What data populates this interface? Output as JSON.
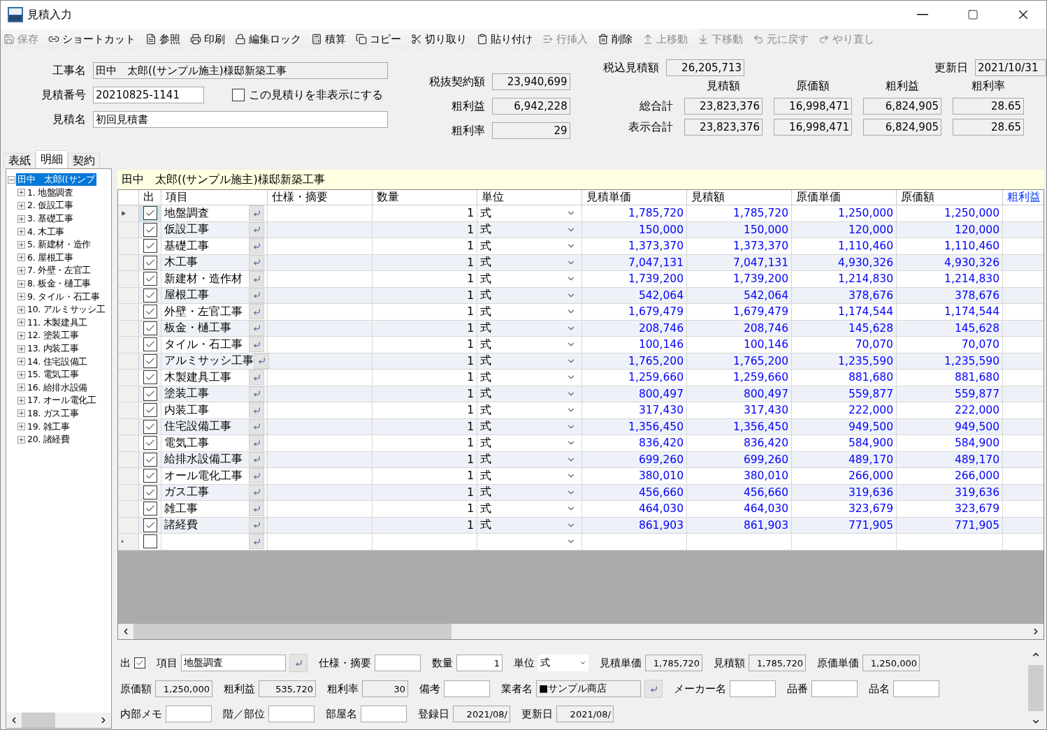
{
  "window": {
    "title": "見積入力"
  },
  "toolbar": [
    {
      "label": "保存",
      "disabled": true
    },
    {
      "label": "ショートカット",
      "disabled": false
    },
    {
      "label": "参照",
      "disabled": false
    },
    {
      "label": "印刷",
      "disabled": false
    },
    {
      "label": "編集ロック",
      "disabled": false
    },
    {
      "label": "積算",
      "disabled": false
    },
    {
      "label": "コピー",
      "disabled": false
    },
    {
      "label": "切り取り",
      "disabled": false
    },
    {
      "label": "貼り付け",
      "disabled": false
    },
    {
      "label": "行挿入",
      "disabled": true
    },
    {
      "label": "削除",
      "disabled": false
    },
    {
      "label": "上移動",
      "disabled": true
    },
    {
      "label": "下移動",
      "disabled": true
    },
    {
      "label": "元に戻す",
      "disabled": true
    },
    {
      "label": "やり直し",
      "disabled": true
    }
  ],
  "header": {
    "project_name": {
      "label": "工事名",
      "value": "田中　太郎((サンプル施主)様邸新築工事"
    },
    "estimate_number": {
      "label": "見積番号",
      "value": "20210825-1141"
    },
    "hide_option": {
      "label": "この見積りを非表示にする",
      "checked": false
    },
    "estimate_name": {
      "label": "見積名",
      "value": "初回見積書"
    },
    "contract": [
      {
        "label": "税抜契約額",
        "value": "23,940,699"
      },
      {
        "label": "粗利益",
        "value": "6,942,228"
      },
      {
        "label": "粗利率",
        "value": "29"
      }
    ],
    "tax_included": {
      "label": "税込見積額",
      "value": "26,205,713"
    },
    "updated": {
      "label": "更新日",
      "value": "2021/10/31"
    },
    "summary": {
      "columns": [
        "見積額",
        "原価額",
        "粗利益",
        "粗利率"
      ],
      "rows": [
        {
          "label": "総合計",
          "values": [
            "23,823,376",
            "16,998,471",
            "6,824,905",
            "28.65"
          ]
        },
        {
          "label": "表示合計",
          "values": [
            "23,823,376",
            "16,998,471",
            "6,824,905",
            "28.65"
          ]
        }
      ]
    }
  },
  "tabs": [
    {
      "label": "表紙",
      "selected": false
    },
    {
      "label": "明細",
      "selected": true
    },
    {
      "label": "契約",
      "selected": false
    }
  ],
  "tree": {
    "root": {
      "label": "田中　太郎((サンプ",
      "selected": true,
      "expanded": true,
      "children": [
        {
          "label": "1. 地盤調査",
          "expanded": false
        },
        {
          "label": "2. 仮設工事",
          "expanded": false
        },
        {
          "label": "3. 基礎工事",
          "expanded": false
        },
        {
          "label": "4. 木工事",
          "expanded": false
        },
        {
          "label": "5. 新建材・造作",
          "expanded": false
        },
        {
          "label": "6. 屋根工事",
          "expanded": false
        },
        {
          "label": "7. 外壁・左官工",
          "expanded": false
        },
        {
          "label": "8. 板金・樋工事",
          "expanded": false
        },
        {
          "label": "9. タイル・石工事",
          "expanded": false
        },
        {
          "label": "10. アルミサッシ工",
          "expanded": false
        },
        {
          "label": "11. 木製建具工",
          "expanded": false
        },
        {
          "label": "12. 塗装工事",
          "expanded": false
        },
        {
          "label": "13. 内装工事",
          "expanded": false
        },
        {
          "label": "14. 住宅設備工",
          "expanded": false
        },
        {
          "label": "15. 電気工事",
          "expanded": false
        },
        {
          "label": "16. 給排水設備",
          "expanded": false
        },
        {
          "label": "17. オール電化工",
          "expanded": false
        },
        {
          "label": "18. ガス工事",
          "expanded": false
        },
        {
          "label": "19. 雑工事",
          "expanded": false
        },
        {
          "label": "20. 諸経費",
          "expanded": false
        }
      ]
    }
  },
  "grid": {
    "caption": "田中　太郎((サンプル施主)様邸新築工事",
    "columns": [
      {
        "label": "出",
        "accent": false
      },
      {
        "label": "項目",
        "accent": false
      },
      {
        "label": "仕様・摘要",
        "accent": false
      },
      {
        "label": "数量",
        "accent": false
      },
      {
        "label": "単位",
        "accent": false
      },
      {
        "label": "見積単価",
        "accent": false
      },
      {
        "label": "見積額",
        "accent": false
      },
      {
        "label": "原価単価",
        "accent": false
      },
      {
        "label": "原価額",
        "accent": false
      },
      {
        "label": "粗利益",
        "accent": true
      }
    ],
    "rows": [
      {
        "kind": "item",
        "selected": true,
        "checked": true,
        "item": "地盤調査",
        "quantity": "1",
        "unit": "式",
        "unit_price": "1,785,720",
        "amount": "1,785,720",
        "cost_unit_price": "1,250,000",
        "cost": "1,250,000"
      },
      {
        "kind": "item",
        "selected": false,
        "checked": true,
        "item": "仮設工事",
        "quantity": "1",
        "unit": "式",
        "unit_price": "150,000",
        "amount": "150,000",
        "cost_unit_price": "120,000",
        "cost": "120,000"
      },
      {
        "kind": "item",
        "selected": false,
        "checked": true,
        "item": "基礎工事",
        "quantity": "1",
        "unit": "式",
        "unit_price": "1,373,370",
        "amount": "1,373,370",
        "cost_unit_price": "1,110,460",
        "cost": "1,110,460"
      },
      {
        "kind": "item",
        "selected": false,
        "checked": true,
        "item": "木工事",
        "quantity": "1",
        "unit": "式",
        "unit_price": "7,047,131",
        "amount": "7,047,131",
        "cost_unit_price": "4,930,326",
        "cost": "4,930,326"
      },
      {
        "kind": "item",
        "selected": false,
        "checked": true,
        "item": "新建材・造作材",
        "quantity": "1",
        "unit": "式",
        "unit_price": "1,739,200",
        "amount": "1,739,200",
        "cost_unit_price": "1,214,830",
        "cost": "1,214,830"
      },
      {
        "kind": "item",
        "selected": false,
        "checked": true,
        "item": "屋根工事",
        "quantity": "1",
        "unit": "式",
        "unit_price": "542,064",
        "amount": "542,064",
        "cost_unit_price": "378,676",
        "cost": "378,676"
      },
      {
        "kind": "item",
        "selected": false,
        "checked": true,
        "item": "外壁・左官工事",
        "quantity": "1",
        "unit": "式",
        "unit_price": "1,679,479",
        "amount": "1,679,479",
        "cost_unit_price": "1,174,544",
        "cost": "1,174,544"
      },
      {
        "kind": "item",
        "selected": false,
        "checked": true,
        "item": "板金・樋工事",
        "quantity": "1",
        "unit": "式",
        "unit_price": "208,746",
        "amount": "208,746",
        "cost_unit_price": "145,628",
        "cost": "145,628"
      },
      {
        "kind": "item",
        "selected": false,
        "checked": true,
        "item": "タイル・石工事",
        "quantity": "1",
        "unit": "式",
        "unit_price": "100,146",
        "amount": "100,146",
        "cost_unit_price": "70,070",
        "cost": "70,070"
      },
      {
        "kind": "item",
        "selected": false,
        "checked": true,
        "item": "アルミサッシ工事",
        "quantity": "1",
        "unit": "式",
        "unit_price": "1,765,200",
        "amount": "1,765,200",
        "cost_unit_price": "1,235,590",
        "cost": "1,235,590"
      },
      {
        "kind": "item",
        "selected": false,
        "checked": true,
        "item": "木製建具工事",
        "quantity": "1",
        "unit": "式",
        "unit_price": "1,259,660",
        "amount": "1,259,660",
        "cost_unit_price": "881,680",
        "cost": "881,680"
      },
      {
        "kind": "item",
        "selected": false,
        "checked": true,
        "item": "塗装工事",
        "quantity": "1",
        "unit": "式",
        "unit_price": "800,497",
        "amount": "800,497",
        "cost_unit_price": "559,877",
        "cost": "559,877"
      },
      {
        "kind": "item",
        "selected": false,
        "checked": true,
        "item": "内装工事",
        "quantity": "1",
        "unit": "式",
        "unit_price": "317,430",
        "amount": "317,430",
        "cost_unit_price": "222,000",
        "cost": "222,000"
      },
      {
        "kind": "item",
        "selected": false,
        "checked": true,
        "item": "住宅設備工事",
        "quantity": "1",
        "unit": "式",
        "unit_price": "1,356,450",
        "amount": "1,356,450",
        "cost_unit_price": "949,500",
        "cost": "949,500"
      },
      {
        "kind": "item",
        "selected": false,
        "checked": true,
        "item": "電気工事",
        "quantity": "1",
        "unit": "式",
        "unit_price": "836,420",
        "amount": "836,420",
        "cost_unit_price": "584,900",
        "cost": "584,900"
      },
      {
        "kind": "item",
        "selected": false,
        "checked": true,
        "item": "給排水設備工事",
        "quantity": "1",
        "unit": "式",
        "unit_price": "699,260",
        "amount": "699,260",
        "cost_unit_price": "489,170",
        "cost": "489,170"
      },
      {
        "kind": "item",
        "selected": false,
        "checked": true,
        "item": "オール電化工事",
        "quantity": "1",
        "unit": "式",
        "unit_price": "380,010",
        "amount": "380,010",
        "cost_unit_price": "266,000",
        "cost": "266,000"
      },
      {
        "kind": "item",
        "selected": false,
        "checked": true,
        "item": "ガス工事",
        "quantity": "1",
        "unit": "式",
        "unit_price": "456,660",
        "amount": "456,660",
        "cost_unit_price": "319,636",
        "cost": "319,636"
      },
      {
        "kind": "item",
        "selected": false,
        "checked": true,
        "item": "雑工事",
        "quantity": "1",
        "unit": "式",
        "unit_price": "464,030",
        "amount": "464,030",
        "cost_unit_price": "323,679",
        "cost": "323,679"
      },
      {
        "kind": "item",
        "selected": false,
        "checked": true,
        "item": "諸経費",
        "quantity": "1",
        "unit": "式",
        "unit_price": "861,903",
        "amount": "861,903",
        "cost_unit_price": "771,905",
        "cost": "771,905"
      },
      {
        "kind": "new",
        "selected": false,
        "checked": false
      }
    ]
  },
  "detail": {
    "rows": [
      [
        {
          "kind": "check",
          "label": "出",
          "checked": true
        },
        {
          "kind": "picker",
          "label": "項目",
          "value": "地盤調査"
        },
        {
          "kind": "text",
          "label": "仕様・摘要"
        },
        {
          "kind": "number",
          "label": "数量",
          "value": "1"
        },
        {
          "kind": "select",
          "label": "単位",
          "value": "式"
        },
        {
          "kind": "readonly",
          "label": "見積単価",
          "value": "1,785,720"
        },
        {
          "kind": "readonly",
          "label": "見積額",
          "value": "1,785,720"
        },
        {
          "kind": "readonly",
          "label": "原価単価",
          "value": "1,250,000"
        }
      ],
      [
        {
          "kind": "readonly",
          "label": "原価額",
          "value": "1,250,000"
        },
        {
          "kind": "readonly",
          "label": "粗利益",
          "value": "535,720"
        },
        {
          "kind": "readonly",
          "label": "粗利率",
          "value": "30"
        },
        {
          "kind": "text",
          "label": "備考"
        },
        {
          "kind": "readonly-picker",
          "label": "業者名",
          "value": "■サンプル商店"
        },
        {
          "kind": "text",
          "label": "メーカー名"
        },
        {
          "kind": "text",
          "label": "品番"
        },
        {
          "kind": "text",
          "label": "品名"
        }
      ],
      [
        {
          "kind": "text",
          "label": "内部メモ"
        },
        {
          "kind": "text",
          "label": "階／部位"
        },
        {
          "kind": "text",
          "label": "部屋名"
        },
        {
          "kind": "readonly",
          "label": "登録日",
          "value": "2021/08/"
        },
        {
          "kind": "readonly",
          "label": "更新日",
          "value": "2021/08/"
        }
      ]
    ]
  }
}
